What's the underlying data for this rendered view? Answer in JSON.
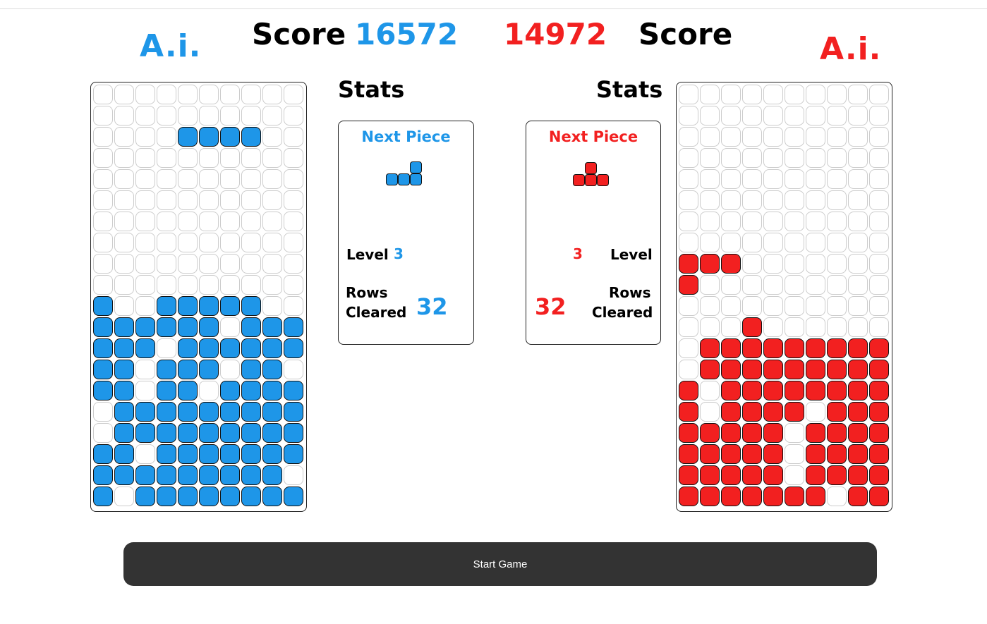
{
  "players": {
    "left": {
      "name": "A.i.",
      "score_label": "Score",
      "score": "16572",
      "color": "#1e96e8"
    },
    "right": {
      "name": "A.i.",
      "score_label": "Score",
      "score": "14972",
      "color": "#f22020"
    }
  },
  "stats": {
    "left": {
      "title": "Stats",
      "next_piece_label": "Next Piece",
      "next_piece": "L",
      "level_label": "Level",
      "level": "3",
      "rows_label_1": "Rows",
      "rows_label_2": "Cleared",
      "rows_cleared": "32"
    },
    "right": {
      "title": "Stats",
      "next_piece_label": "Next Piece",
      "next_piece": "T",
      "level_label": "Level",
      "level": "3",
      "rows_label_1": "Rows",
      "rows_label_2": "Cleared",
      "rows_cleared": "32"
    }
  },
  "boards": {
    "left": [
      "..........",
      "..........",
      "....####..",
      "..........",
      "..........",
      "..........",
      "..........",
      "..........",
      "..........",
      "..........",
      "#..#####..",
      "######.###",
      "###.######",
      "##.###.##.",
      "##.##.####",
      ".#########",
      ".#########",
      "##.#######",
      "#########.",
      "#.########"
    ],
    "right": [
      "..........",
      "..........",
      "..........",
      "..........",
      "..........",
      "..........",
      "..........",
      "..........",
      "###.......",
      "#.........",
      "..........",
      "...#......",
      ".#########",
      ".#########",
      "#.########",
      "#.####.###",
      "#####.####",
      "#####.####",
      "#####.####",
      "#######.##"
    ]
  },
  "controls": {
    "start_label": "Start Game"
  }
}
